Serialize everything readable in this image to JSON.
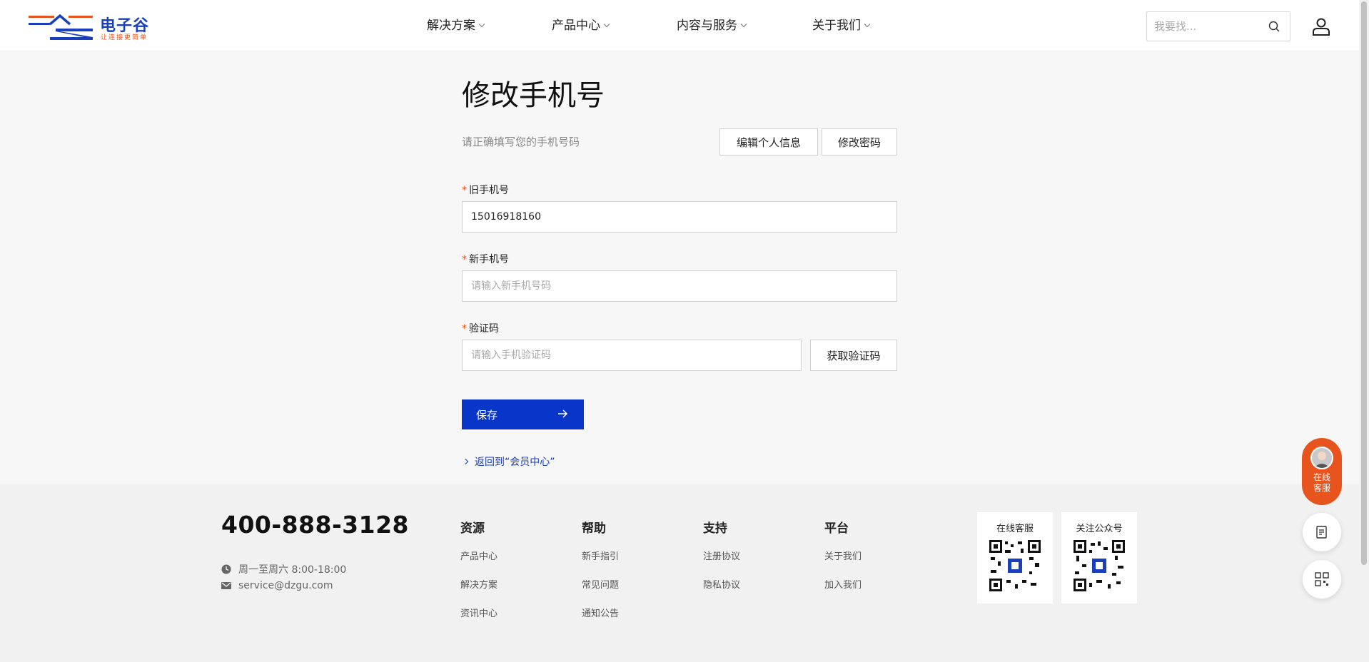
{
  "header": {
    "logo_text": "电子谷",
    "logo_slogan": "让连接更简单",
    "nav": [
      {
        "label": "解决方案"
      },
      {
        "label": "产品中心"
      },
      {
        "label": "内容与服务"
      },
      {
        "label": "关于我们"
      }
    ],
    "search_placeholder": "我要找..."
  },
  "main": {
    "title": "修改手机号",
    "subtitle": "请正确填写您的手机号码",
    "edit_profile_label": "编辑个人信息",
    "change_password_label": "修改密码",
    "old_phone_label": "旧手机号",
    "old_phone_value": "15016918160",
    "new_phone_label": "新手机号",
    "new_phone_placeholder": "请输入新手机号码",
    "code_label": "验证码",
    "code_placeholder": "请输入手机验证码",
    "get_code_label": "获取验证码",
    "save_label": "保存",
    "back_link": "返回到“会员中心”",
    "required_mark": "*"
  },
  "footer": {
    "phone": "400-888-3128",
    "hours": "周一至周六 8:00-18:00",
    "email": "service@dzgu.com",
    "columns": [
      {
        "title": "资源",
        "links": [
          "产品中心",
          "解决方案",
          "资讯中心"
        ]
      },
      {
        "title": "帮助",
        "links": [
          "新手指引",
          "常见问题",
          "通知公告"
        ]
      },
      {
        "title": "支持",
        "links": [
          "注册协议",
          "隐私协议"
        ]
      },
      {
        "title": "平台",
        "links": [
          "关于我们",
          "加入我们"
        ]
      }
    ],
    "qr_online_service": "在线客服",
    "qr_official_account": "关注公众号"
  },
  "floating": {
    "service_label": "在线客服"
  },
  "colors": {
    "brand_blue": "#0a35c9",
    "brand_orange": "#e8541e"
  }
}
